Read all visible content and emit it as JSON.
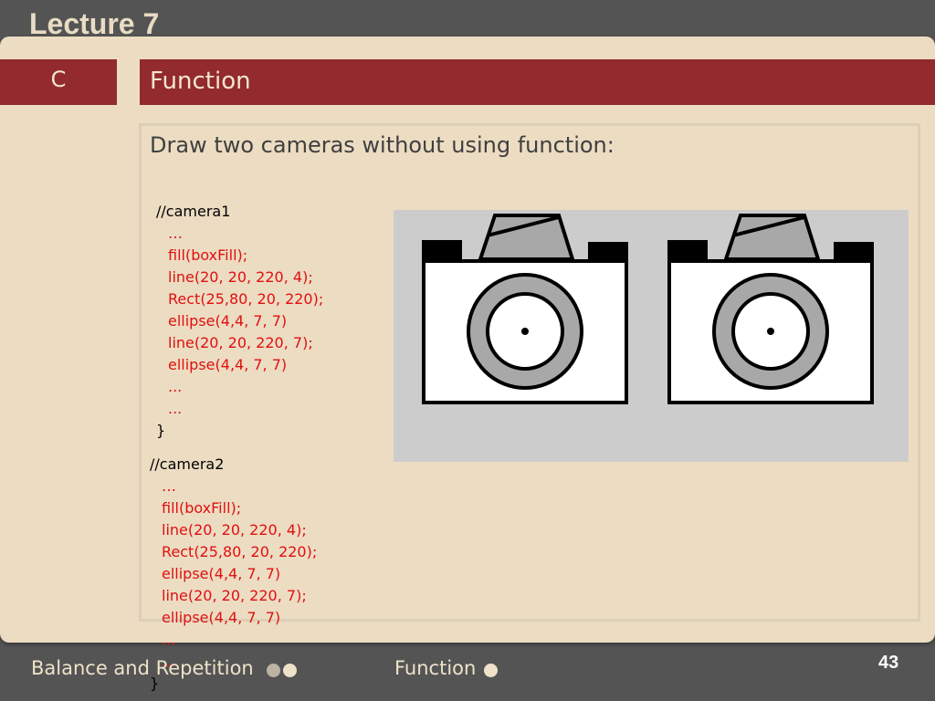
{
  "header": {
    "lecture_title": "Lecture 7"
  },
  "section_tab": {
    "label": "C"
  },
  "slide": {
    "title": "Function",
    "heading": "Draw two cameras without using function:",
    "code_block_1": {
      "comment": "//camera1",
      "lines": [
        "…",
        "fill(boxFill);",
        "line(20, 20, 220, 4);",
        "Rect(25,80, 20, 220);",
        "ellipse(4,4, 7, 7)",
        "line(20, 20, 220, 7);",
        "ellipse(4,4, 7, 7)",
        "...",
        "..."
      ],
      "closing": "}"
    },
    "code_block_2": {
      "comment": "//camera2",
      "lines": [
        "…",
        "fill(boxFill);",
        "line(20, 20, 220, 4);",
        "Rect(25,80, 20, 220);",
        "ellipse(4,4, 7, 7)",
        "line(20, 20, 220, 7);",
        "ellipse(4,4, 7, 7)",
        "...",
        "..."
      ],
      "closing": "}"
    }
  },
  "footer": {
    "left_label": "Balance and Repetition",
    "mid_label": "Function",
    "page_number": "43"
  },
  "colors": {
    "background": "#545454",
    "slide": "#ecdcc2",
    "accent": "#922a2e",
    "code_red": "#e01010"
  },
  "icons": [
    "camera-icon",
    "dot-indicator"
  ]
}
